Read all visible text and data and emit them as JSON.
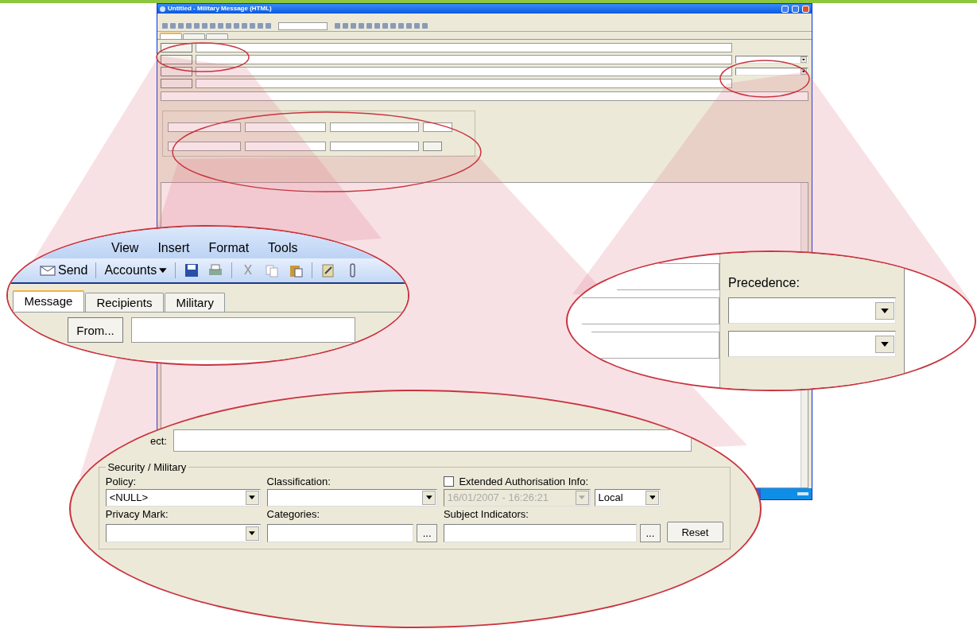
{
  "window": {
    "title": "Untitled - Military Message (HTML)",
    "tabs": [
      {
        "selected": true
      },
      {
        "selected": false
      },
      {
        "selected": false
      }
    ]
  },
  "menu_callout": {
    "menu": [
      "View",
      "Insert",
      "Format",
      "Tools"
    ],
    "send": "Send",
    "accounts": "Accounts",
    "tabs": [
      {
        "label": "Message",
        "selected": true
      },
      {
        "label": "Recipients",
        "selected": false
      },
      {
        "label": "Military",
        "selected": false
      }
    ],
    "from": "From..."
  },
  "precedence_callout": {
    "label": "Precedence:"
  },
  "security_callout": {
    "subject_label": "ect:",
    "security": {
      "title": "Security / Military",
      "policy_label": "Policy:",
      "policy_value": "<NULL>",
      "classification_label": "Classification:",
      "extended": {
        "label": "Extended Authorisation Info:",
        "checked": false
      },
      "date": {
        "value": "16/01/2007 - 16:26:21",
        "disabled": true
      },
      "zone": "Local",
      "privacy_label": "Privacy Mark:",
      "categories_label": "Categories:",
      "subject_indicators_label": "Subject Indicators:",
      "browse": "...",
      "reset": "Reset"
    }
  }
}
